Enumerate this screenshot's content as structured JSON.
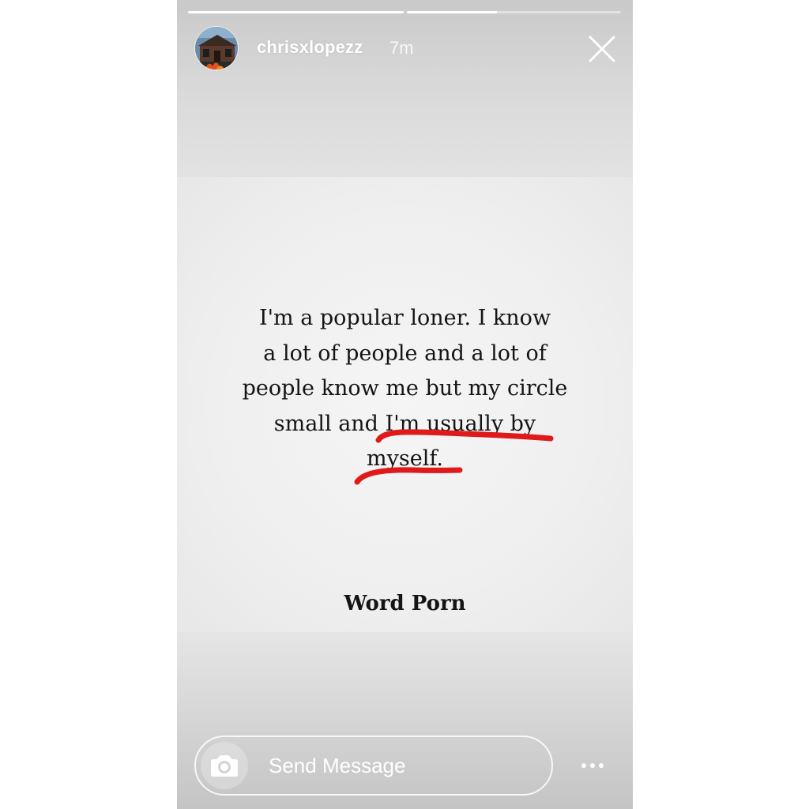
{
  "story": {
    "progress": [
      {
        "segment": 1,
        "fraction": 1.0
      },
      {
        "segment": 2,
        "fraction": 0.42
      }
    ],
    "header": {
      "username": "chrisxlopezz",
      "timestamp": "7m",
      "close_icon": "close-icon"
    },
    "post": {
      "quote_lines": [
        "I'm a popular loner. I know",
        "a lot of people and a lot of",
        "people know me but my circle",
        "small and I'm usually by",
        "myself."
      ],
      "signature": "Word Porn",
      "highlight_color": "#e01a1a"
    },
    "footer": {
      "message_placeholder": "Send Message",
      "camera_icon": "camera-icon",
      "more_icon": "more-dots-icon"
    }
  }
}
